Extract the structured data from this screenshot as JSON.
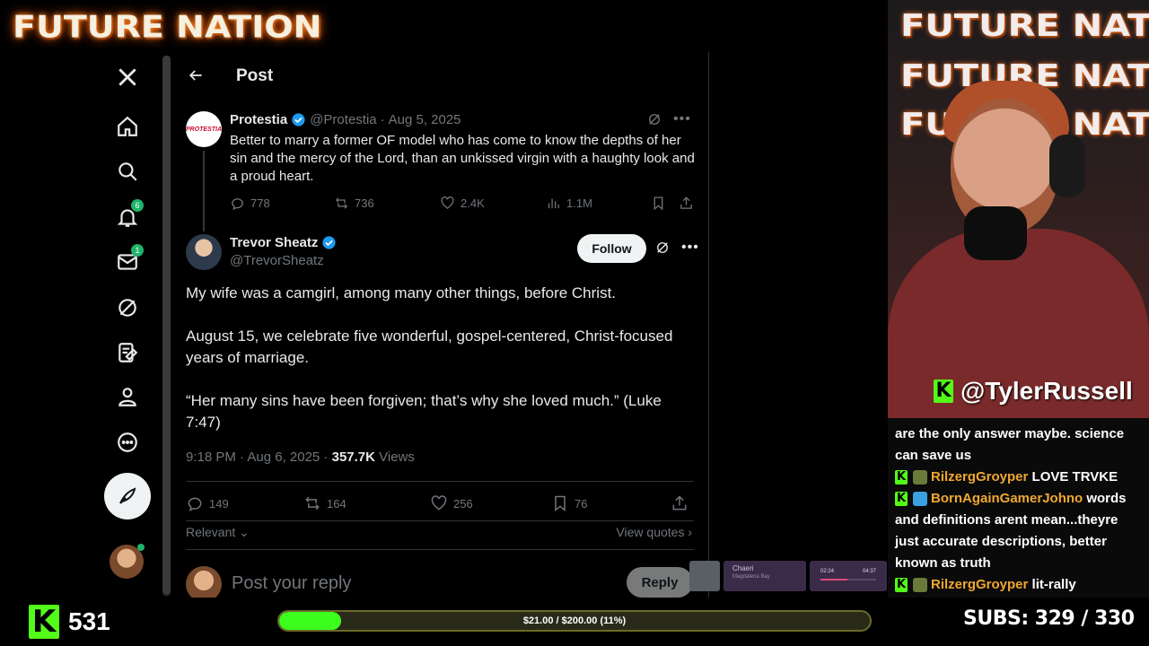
{
  "stream": {
    "brand": "FUTURE NATION",
    "cam_bg_text": [
      "FUTURE NATION",
      "FUTURE NATION",
      "FUTURE NATION"
    ],
    "cam_handle": "@TylerRussell",
    "kick_count": "531",
    "goal_text": "$21.00 / $200.00 (11%)",
    "goal_progress": 0.105,
    "subs_label": "SUBS:",
    "subs_value": "329 / 330",
    "kick_letter": "K"
  },
  "sidebar": {
    "icons": [
      "x-logo-icon",
      "home-icon",
      "search-icon",
      "notifications-icon",
      "messages-icon",
      "grok-icon",
      "lists-icon",
      "profile-icon",
      "more-icon"
    ],
    "notifications_badge": "6",
    "messages_badge": "1"
  },
  "header": {
    "title": "Post"
  },
  "parent_post": {
    "avatar_text": "PROTESTIA",
    "name": "Protestia",
    "handle": "@Protestia",
    "sep": "·",
    "date": "Aug 5, 2025",
    "text": "Better to marry a former OF model who has come to know the depths of her sin and the mercy of the Lord, than an unkissed virgin with a haughty look and a proud heart.",
    "replies": "778",
    "reposts": "736",
    "likes": "2.4K",
    "views": "1.1M"
  },
  "main_post": {
    "name": "Trevor Sheatz",
    "handle": "@TrevorSheatz",
    "follow_label": "Follow",
    "paragraphs": [
      "My wife was a camgirl, among many other things, before Christ.",
      "August 15, we celebrate five wonderful, gospel-centered, Christ-focused years of marriage.",
      "“Her many sins have been forgiven; that’s why she loved much.” (Luke 7:47)"
    ],
    "time": "9:18 PM · Aug 6, 2025 · ",
    "views_count": "357.7K",
    "views_label": " Views",
    "replies": "149",
    "reposts": "164",
    "likes": "256",
    "bookmarks": "76"
  },
  "replies_bar": {
    "sort_label": "Relevant",
    "view_quotes": "View quotes",
    "placeholder": "Post your reply",
    "reply_label": "Reply"
  },
  "mini_player": {
    "title": "Chaeri",
    "subtitle": "Magdalena Bay",
    "time_current": "02:24",
    "time_total": "04:37"
  },
  "chat": [
    {
      "user": "",
      "text": "are the only answer maybe. science can save us"
    },
    {
      "user": "RilzergGroyper",
      "text": " LOVE TRVKE"
    },
    {
      "user": "BornAgainGamerJohno",
      "text": " words and definitions arent mean...theyre just accurate descriptions, better known as truth"
    },
    {
      "user": "RilzergGroyper",
      "text": " lit-rally"
    }
  ],
  "colors": {
    "kick_green": "#53fc18",
    "x_blue": "#1d9bf0",
    "goal_fill": "#3cff1e",
    "chat_user": "#f0a830"
  }
}
